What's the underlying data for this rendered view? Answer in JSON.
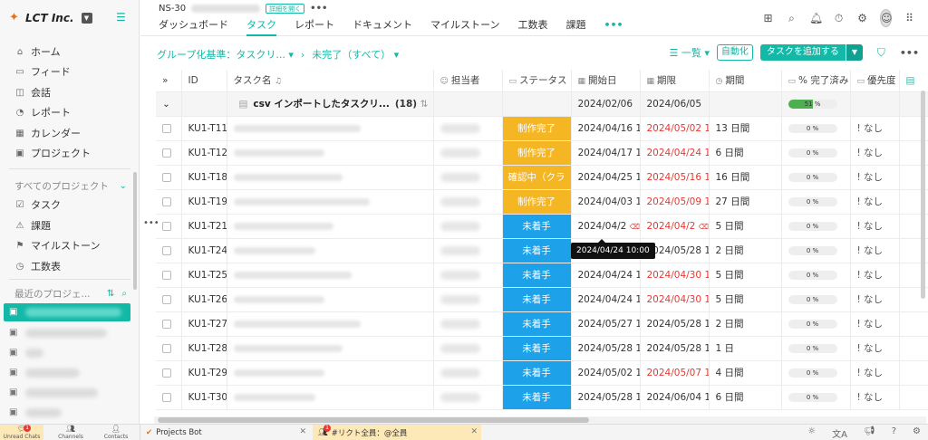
{
  "brand": {
    "name": "LCT Inc."
  },
  "sidebar": {
    "nav": [
      {
        "label": "ホーム",
        "icon": "home-icon"
      },
      {
        "label": "フィード",
        "icon": "feed-icon"
      },
      {
        "label": "会話",
        "icon": "chat-icon"
      },
      {
        "label": "レポート",
        "icon": "report-icon"
      },
      {
        "label": "カレンダー",
        "icon": "calendar-icon"
      },
      {
        "label": "プロジェクト",
        "icon": "project-icon"
      }
    ],
    "all_projects_label": "すべてのプロジェクト",
    "project_nav": [
      {
        "label": "タスク"
      },
      {
        "label": "課題"
      },
      {
        "label": "マイルストーン"
      },
      {
        "label": "工数表"
      }
    ],
    "recent_label": "最近のプロジェ..."
  },
  "header": {
    "project_code": "NS-30",
    "details_badge": "詳細を開く",
    "more": "•••",
    "tabs": [
      "ダッシュボード",
      "タスク",
      "レポート",
      "ドキュメント",
      "マイルストーン",
      "工数表",
      "課題"
    ],
    "tabs_more": "•••",
    "active_tab": "タスク"
  },
  "toolbar": {
    "group_by": "グループ化基準：タスクリ...",
    "filter": "未完了（すべて）",
    "view": "一覧",
    "automation": "自動化",
    "add_task": "タスクを追加する"
  },
  "columns": {
    "id": "ID",
    "name": "タスク名",
    "assignee": "担当者",
    "status": "ステータス",
    "start": "開始日",
    "deadline": "期限",
    "period": "期間",
    "pct": "% 完了済み",
    "priority": "優先度"
  },
  "group": {
    "name": "csv インポートしたタスクリ...",
    "count": "(18)",
    "start": "2024/02/06",
    "deadline": "2024/06/05",
    "pct": "51 %",
    "pct_value": 51
  },
  "rows": [
    {
      "id": "KU1-T11",
      "status": "制作完了",
      "st": "done",
      "start": "2024/04/16 10",
      "deadline": "2024/05/02 1",
      "dl_red": true,
      "period": "13 日間",
      "pct": "0 %",
      "priority": "! なし"
    },
    {
      "id": "KU1-T12",
      "status": "制作完了",
      "st": "done",
      "start": "2024/04/17 10",
      "deadline": "2024/04/24 1",
      "dl_red": true,
      "period": "6 日間",
      "pct": "0 %",
      "priority": "! なし"
    },
    {
      "id": "KU1-T18",
      "status": "確認中（クラ",
      "st": "done",
      "start": "2024/04/25 10",
      "deadline": "2024/05/16 1",
      "dl_red": true,
      "period": "16 日間",
      "pct": "0 %",
      "priority": "! なし"
    },
    {
      "id": "KU1-T19",
      "status": "制作完了",
      "st": "done",
      "start": "2024/04/03 1",
      "deadline": "2024/05/09 1",
      "dl_red": true,
      "period": "27 日間",
      "pct": "0 %",
      "priority": "! なし"
    },
    {
      "id": "KU1-T21",
      "status": "未着手",
      "st": "todo",
      "start": "2024/04/2",
      "deadline": "2024/04/2",
      "dl_red": true,
      "period": "5 日間",
      "pct": "0 %",
      "priority": "! なし",
      "cal": true
    },
    {
      "id": "KU1-T24",
      "status": "未着手",
      "st": "todo",
      "start": "",
      "deadline": "2024/05/28 1",
      "dl_red": false,
      "period": "2 日間",
      "pct": "0 %",
      "priority": "! なし"
    },
    {
      "id": "KU1-T25",
      "status": "未着手",
      "st": "todo",
      "start": "2024/04/24 10",
      "deadline": "2024/04/30 1",
      "dl_red": true,
      "period": "5 日間",
      "pct": "0 %",
      "priority": "! なし"
    },
    {
      "id": "KU1-T26",
      "status": "未着手",
      "st": "todo",
      "start": "2024/04/24 10",
      "deadline": "2024/04/30 1",
      "dl_red": true,
      "period": "5 日間",
      "pct": "0 %",
      "priority": "! なし"
    },
    {
      "id": "KU1-T27",
      "status": "未着手",
      "st": "todo",
      "start": "2024/05/27 10",
      "deadline": "2024/05/28 1",
      "dl_red": false,
      "period": "2 日間",
      "pct": "0 %",
      "priority": "! なし"
    },
    {
      "id": "KU1-T28",
      "status": "未着手",
      "st": "todo",
      "start": "2024/05/28 10",
      "deadline": "2024/05/28 1",
      "dl_red": false,
      "period": "1 日",
      "pct": "0 %",
      "priority": "! なし"
    },
    {
      "id": "KU1-T29",
      "status": "未着手",
      "st": "todo",
      "start": "2024/05/02 10",
      "deadline": "2024/05/07 1",
      "dl_red": true,
      "period": "4 日間",
      "pct": "0 %",
      "priority": "! なし"
    },
    {
      "id": "KU1-T30",
      "status": "未着手",
      "st": "todo",
      "start": "2024/05/28 10",
      "deadline": "2024/06/04 1",
      "dl_red": false,
      "period": "6 日間",
      "pct": "0 %",
      "priority": "! なし"
    }
  ],
  "tooltip": "2024/04/24 10:00",
  "bottom": {
    "unread": "Unread Chats",
    "channels": "Channels",
    "contacts": "Contacts",
    "chat1": "Projects Bot",
    "chat2": "#リクト全員：@全員",
    "badge": "1"
  }
}
